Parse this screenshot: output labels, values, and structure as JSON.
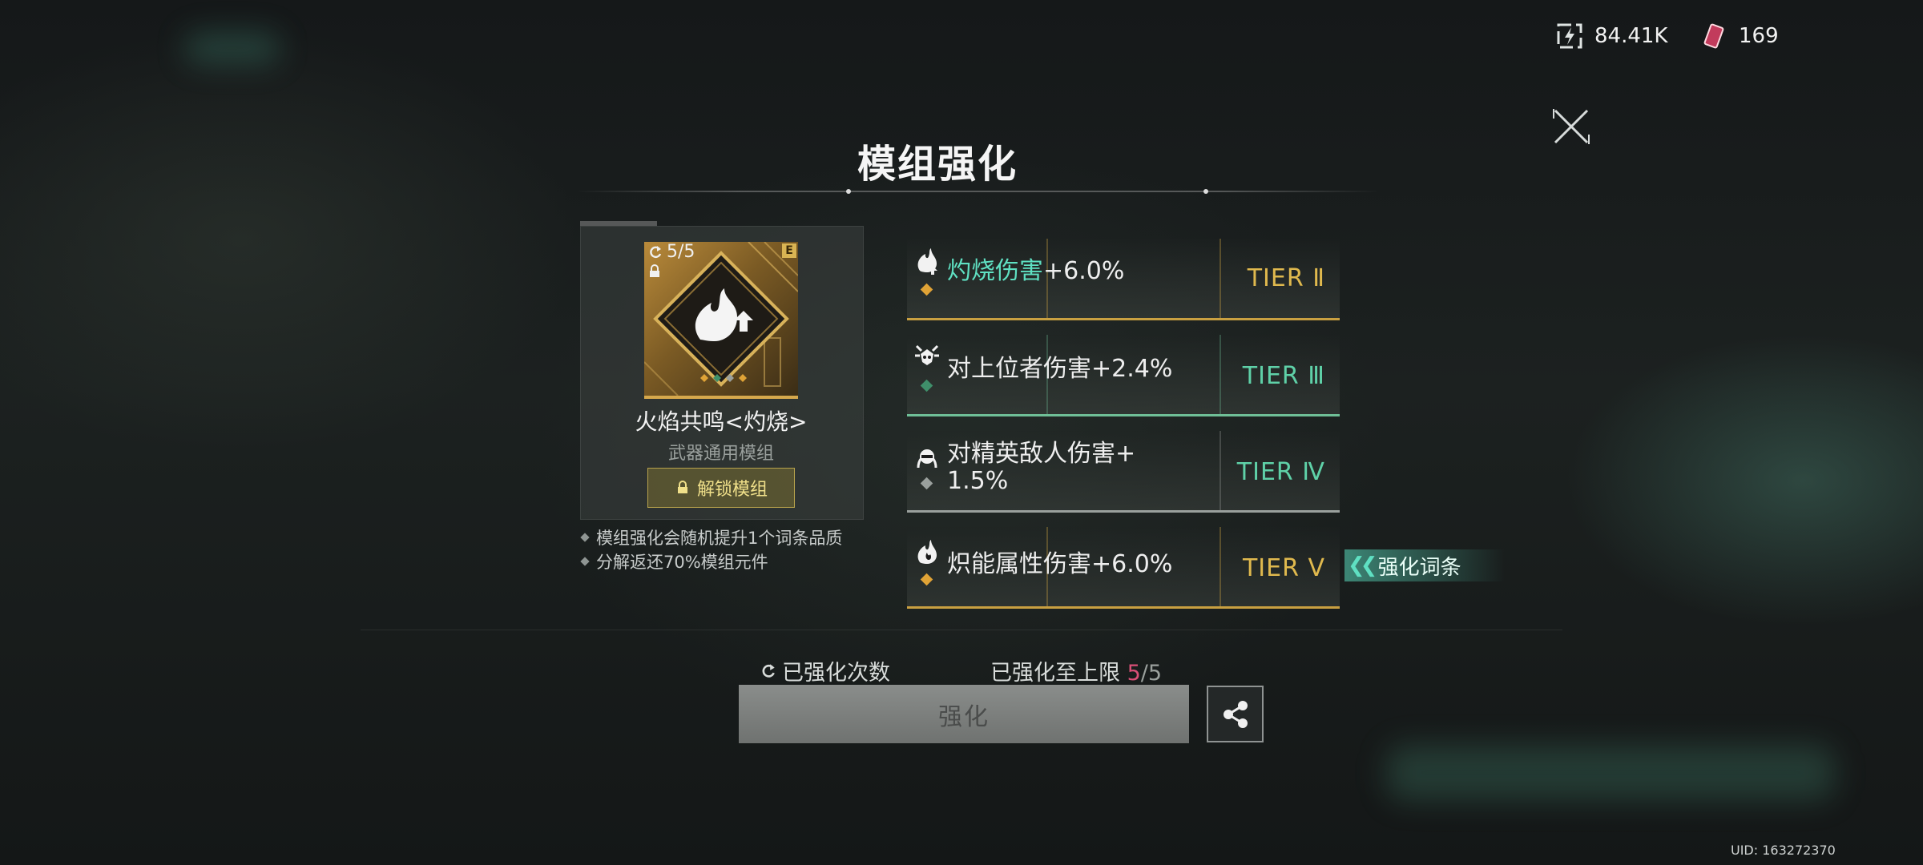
{
  "resources": {
    "energy": "84.41K",
    "gems": "169"
  },
  "title": "模组强化",
  "module": {
    "count": "5/5",
    "badge": "E",
    "name": "火焰共鸣<灼烧>",
    "type": "武器通用模组",
    "unlock_label": "解锁模组"
  },
  "notes": [
    "模组强化会随机提升1个词条品质",
    "分解返还70%模组元件"
  ],
  "affixes": [
    {
      "text_highlight": "灼烧伤害",
      "text": "+6.0%",
      "tier": "TIER Ⅱ",
      "tier_color": "#e0b94e",
      "line_color": "#c9a041",
      "gem_color": "#e0a336"
    },
    {
      "text_highlight": "",
      "text": "对上位者伤害+2.4%",
      "tier": "TIER Ⅲ",
      "tier_color": "#5fd1a8",
      "line_color": "#6fbf97",
      "gem_color": "#3f8f6a"
    },
    {
      "text_highlight": "",
      "text": "对精英敌人伤害+",
      "text2": "1.5%",
      "tier": "TIER Ⅳ",
      "tier_color": "#5fd1a8",
      "line_color": "#9aa09d",
      "gem_color": "#9aa09d"
    },
    {
      "text_highlight": "",
      "text": "炽能属性伤害+6.0%",
      "tier": "TIER Ⅴ",
      "tier_color": "#e0b94e",
      "line_color": "#c9a041",
      "gem_color": "#e0a336"
    }
  ],
  "enhance_tag": "强化词条",
  "stats": {
    "count_label": "已强化次数",
    "limit_label": "已强化至上限",
    "limit_current": "5",
    "limit_sep": "/",
    "limit_max": "5"
  },
  "enhance_button": "强化",
  "uid": "UID: 163272370",
  "colors": {
    "accent_teal": "#5fe0c2",
    "gold": "#e0b94e",
    "pink": "#d94f77"
  }
}
